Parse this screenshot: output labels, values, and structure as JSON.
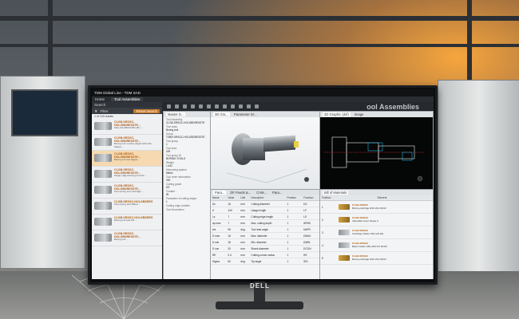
{
  "app": {
    "title": "TDM Global Line - TDM SAD",
    "tool_title": "ool Assemblies"
  },
  "menu": {
    "home": "Home",
    "tab_active": "Tool Assemblies"
  },
  "sidebar": {
    "search_placeholder": "Search",
    "filter_label": "Filter",
    "reset_label": "Reset search",
    "result_count": "1 of 100 results",
    "items": [
      {
        "title": "CLGB-SRSGC-HOLGBDRESSTE...",
        "desc": "Side-CH-R8X32-BG-00 | ...",
        "sel": false
      },
      {
        "title": "CLGB-SRSGC-HOLGBDRESSTE...",
        "desc": "Boring tool no blue edged HSC-DG Kappa...",
        "sel": false
      },
      {
        "title": "CLGB-SRSGC-HOLGBDRESSTE...",
        "desc": "Boring tool tool kappa ...",
        "sel": true
      },
      {
        "title": "CLGB-SRSGC-HOLGBDRESSTE...",
        "desc": "Single edged boring tool HG ...",
        "sel": false
      },
      {
        "title": "CLGB-SRSGC-HOLGBDRESSTE...",
        "desc": "Fine boring tool Cartridge ...",
        "sel": false
      },
      {
        "title": "CLGB-SRSGC-HOLGBDRES",
        "desc": "Fine boring and Milled ...",
        "sel": false
      },
      {
        "title": "CLGB-SRSGC-HOLGBDRES",
        "desc": "Boring tool and KR ...",
        "sel": false
      },
      {
        "title": "CLGB-SRSGC-HOLGBDRESSTE...",
        "desc": "Boring tool ...",
        "sel": false
      }
    ]
  },
  "master": {
    "tab": "Master D...",
    "fields": [
      {
        "label": "Tool Assembly",
        "value": "CLGB-SRSGC-HOLGBDRESSTE"
      },
      {
        "label": "Tool class",
        "value": "Boring tool"
      },
      {
        "label": "Group",
        "value": "TGBH-SRSGC-HOLGBDRESSTE"
      },
      {
        "label": "Tool group",
        "value": "1"
      },
      {
        "label": "Tool area",
        "value": "029"
      },
      {
        "label": "Tool group ID",
        "value": "BORING TOOLS"
      },
      {
        "label": "Weight",
        "value": "1.442"
      },
      {
        "label": "Measuring system",
        "value": "Metric"
      },
      {
        "label": "Tool order information",
        "value": "000"
      },
      {
        "label": "Cutting grade",
        "value": "HS"
      },
      {
        "label": "Coolant",
        "value": "IN"
      },
      {
        "label": "Parameter of cutting edges",
        "value": "1"
      },
      {
        "label": "Cutting edge position",
        "value": ""
      },
      {
        "label": "Tool information",
        "value": ""
      }
    ]
  },
  "view3d": {
    "tab1": "3D Gra...",
    "tab2": "Parameter Gr..."
  },
  "view2d": {
    "tab1": "2D Graphic (dxf)",
    "tab2": "Image"
  },
  "params": {
    "tabs": [
      "Para...",
      "DF Feeds &...",
      "CAM...",
      "Para..."
    ],
    "columns": [
      "Name",
      "Value",
      "Unit",
      "Description",
      "Position",
      "Function"
    ],
    "rows": [
      [
        "Dc",
        "16",
        "mm",
        "Cutting diameter",
        "1",
        "DC"
      ],
      [
        "lf",
        "140",
        "mm",
        "Usage length",
        "1",
        "LF"
      ],
      [
        "Ls",
        "7",
        "mm",
        "Cutting edge length",
        "1",
        "LS"
      ],
      [
        "ap max",
        "7",
        "mm",
        "Max. cutting depth",
        "1",
        "APMX"
      ],
      [
        "kre",
        "95",
        "deg",
        "Tool lead angle",
        "1",
        "KAPR"
      ],
      [
        "D max",
        "16",
        "mm",
        "Max. diameter",
        "1",
        "DMAX"
      ],
      [
        "D min",
        "16",
        "mm",
        "Min. diameter",
        "1",
        "DMIN"
      ],
      [
        "D con",
        "20",
        "mm",
        "Shank diameter",
        "1",
        "DCON"
      ],
      [
        "RE",
        "0.4",
        "mm",
        "Cutting corner radius",
        "1",
        "RE"
      ],
      [
        "Sigma",
        "60",
        "deg",
        "Tip angle",
        "1",
        "SIG"
      ]
    ]
  },
  "bom": {
    "tab": "Bill of Materials",
    "columns": [
      "Position",
      "Element"
    ],
    "rows": [
      {
        "pos": "1",
        "title": "CLGB-SRSGC",
        "desc": "Boring cartridge HSC-DG DFO2",
        "grey": false
      },
      {
        "pos": "2",
        "title": "CLGB-SRSGC",
        "desc": "Indexable insert shape C",
        "grey": false
      },
      {
        "pos": "3",
        "title": "CLGB-SRSGC",
        "desc": "Cartridge holder HSC-HK-DG",
        "grey": true
      },
      {
        "pos": "4",
        "title": "CLGB-SRSGC",
        "desc": "Basic holder HSK-A63 KO DFO2",
        "grey": true
      },
      {
        "pos": "5",
        "title": "CLGB-SRSGC",
        "desc": "Boring cartridge HSC-DG DFO2",
        "grey": false
      }
    ]
  },
  "brand": "DELL"
}
